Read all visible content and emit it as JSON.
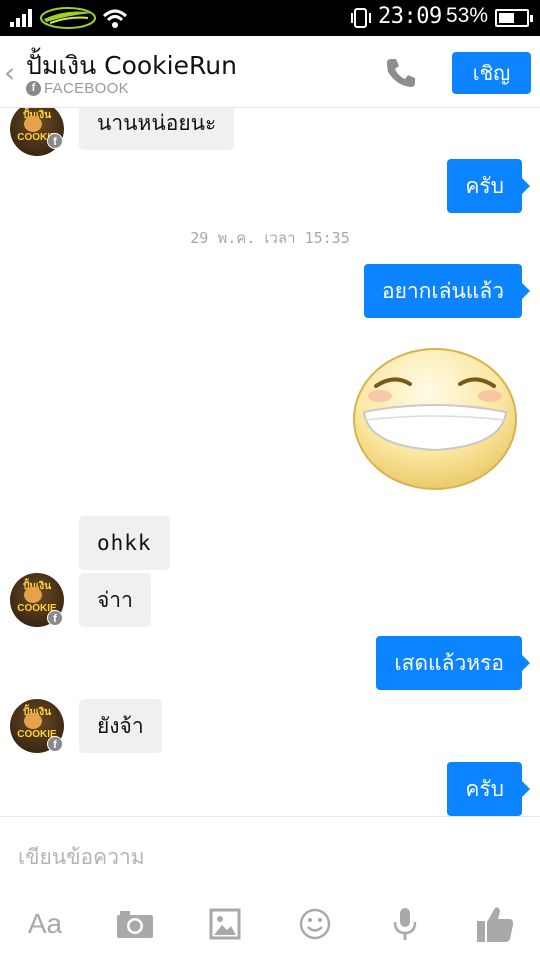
{
  "status_bar": {
    "time": "23:09",
    "battery_percent": "53%",
    "battery_level": 0.53
  },
  "header": {
    "back_glyph": "‹",
    "title": "ปั้มเงิน CookieRun",
    "subtitle": "FACEBOOK",
    "badge_glyph": "f",
    "invite_label": "เชิญ"
  },
  "avatar": {
    "top_text": "ปั้มเงิน",
    "bottom_text": "COOKIE"
  },
  "messages": {
    "m1": "นานหน่อยนะ",
    "m2": "ครับ",
    "timestamp": "29 พ.ค. เวลา 15:35",
    "m3": "อยากเล่นแล้ว",
    "m4": "ohkk",
    "m5": "จ่าา",
    "m6": "เสดแล้วหรอ",
    "m7": "ยังจ้า",
    "m8": "ครับ"
  },
  "composer": {
    "placeholder": "เขียนข้อความ",
    "aa_label": "Aa"
  },
  "colors": {
    "accent": "#0c84ff",
    "incoming_bubble": "#f1f0f0",
    "icon_gray": "#a9a9a9"
  },
  "icons": [
    "signal-icon",
    "carrier-icon",
    "wifi-icon",
    "phone-vibrate-icon",
    "battery-icon",
    "back-icon",
    "facebook-icon",
    "call-icon",
    "camera-icon",
    "image-icon",
    "emoji-icon",
    "microphone-icon",
    "like-icon"
  ]
}
